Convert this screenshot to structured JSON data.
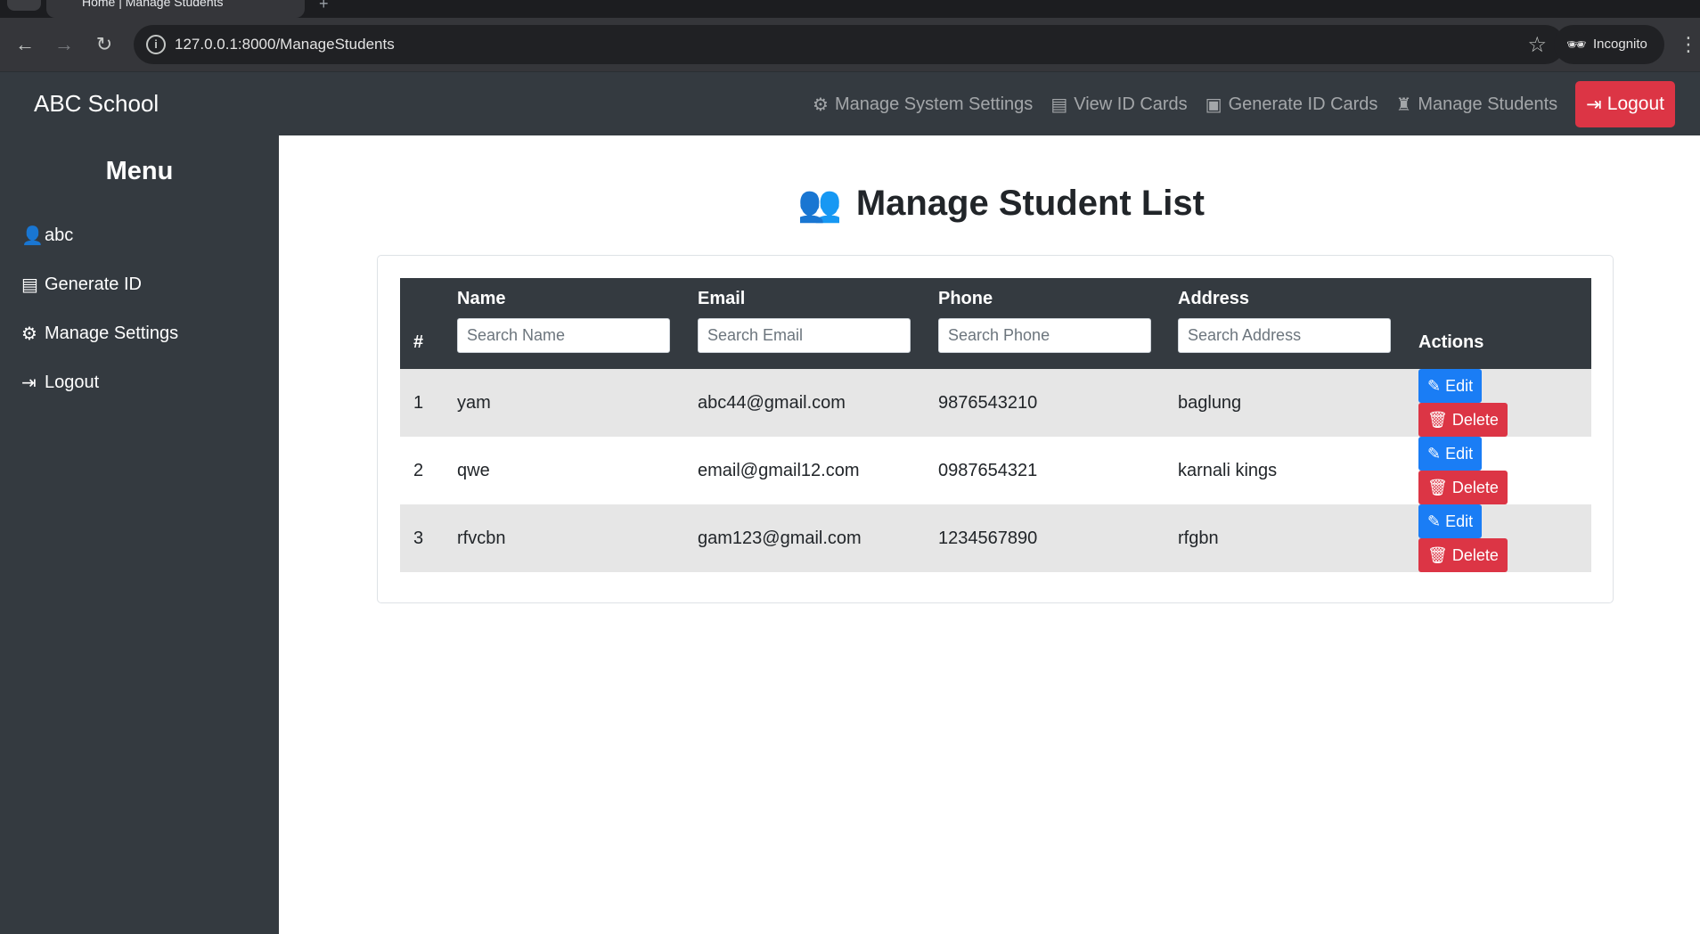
{
  "browser": {
    "tab_title": "Home | Manage Students",
    "url": "127.0.0.1:8000/ManageStudents",
    "profile_label": "Incognito"
  },
  "navbar": {
    "brand": "ABC School",
    "links": [
      {
        "label": "Manage System Settings",
        "icon": "gears-icon"
      },
      {
        "label": "View ID Cards",
        "icon": "id-card-icon"
      },
      {
        "label": "Generate ID Cards",
        "icon": "id-badge-icon"
      },
      {
        "label": "Manage Students",
        "icon": "graduate-icon"
      }
    ],
    "logout_label": "Logout"
  },
  "sidebar": {
    "title": "Menu",
    "items": [
      {
        "label": "abc",
        "icon": "user-icon"
      },
      {
        "label": "Generate ID",
        "icon": "id-card-icon"
      },
      {
        "label": "Manage Settings",
        "icon": "gear-icon"
      },
      {
        "label": "Logout",
        "icon": "sign-out-icon"
      }
    ]
  },
  "main": {
    "title": "Manage Student List",
    "table": {
      "headers": {
        "index": "#",
        "name": "Name",
        "email": "Email",
        "phone": "Phone",
        "address": "Address",
        "actions": "Actions"
      },
      "search": {
        "name": "Search Name",
        "email": "Search Email",
        "phone": "Search Phone",
        "address": "Search Address"
      },
      "rows": [
        {
          "index": "1",
          "name": "yam",
          "email": "abc44@gmail.com",
          "phone": "9876543210",
          "address": "baglung"
        },
        {
          "index": "2",
          "name": "qwe",
          "email": "email@gmail12.com",
          "phone": "0987654321",
          "address": "karnali kings"
        },
        {
          "index": "3",
          "name": "rfvcbn",
          "email": "gam123@gmail.com",
          "phone": "1234567890",
          "address": "rfgbn"
        }
      ],
      "edit_label": "Edit",
      "delete_label": "Delete"
    }
  },
  "colors": {
    "dark": "#343a40",
    "danger": "#dc3545",
    "primary": "#1a7df5"
  }
}
